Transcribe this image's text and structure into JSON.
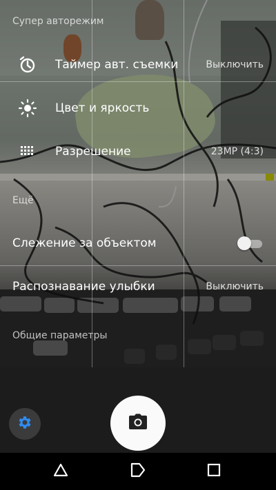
{
  "sections": {
    "super_auto_mode": "Супер авторежим",
    "more": "Ещё",
    "general": "Общие параметры"
  },
  "rows": {
    "self_timer": {
      "label": "Таймер авт. съемки",
      "value": "Выключить",
      "icon": "timer-icon"
    },
    "color_brightness": {
      "label": "Цвет и яркость",
      "icon": "brightness-icon"
    },
    "resolution": {
      "label": "Разрешение",
      "value": "23MP (4:3)",
      "icon": "resolution-grid-icon"
    },
    "object_tracking": {
      "label": "Слежение за объектом",
      "toggle_on": false
    },
    "smile_detection": {
      "label": "Распознавание улыбки",
      "value": "Выключить"
    }
  },
  "camera_bar": {
    "settings_icon": "gear-icon",
    "shutter_icon": "camera-icon"
  },
  "nav_bar": {
    "back_icon": "triangle-back-icon",
    "home_icon": "home-pentagon-icon",
    "recents_icon": "square-recents-icon"
  },
  "colors": {
    "accent": "#2f8cf0",
    "shutter": "#fafafa",
    "bar_bg": "#1c1c1c",
    "nav_bg": "#000000"
  }
}
